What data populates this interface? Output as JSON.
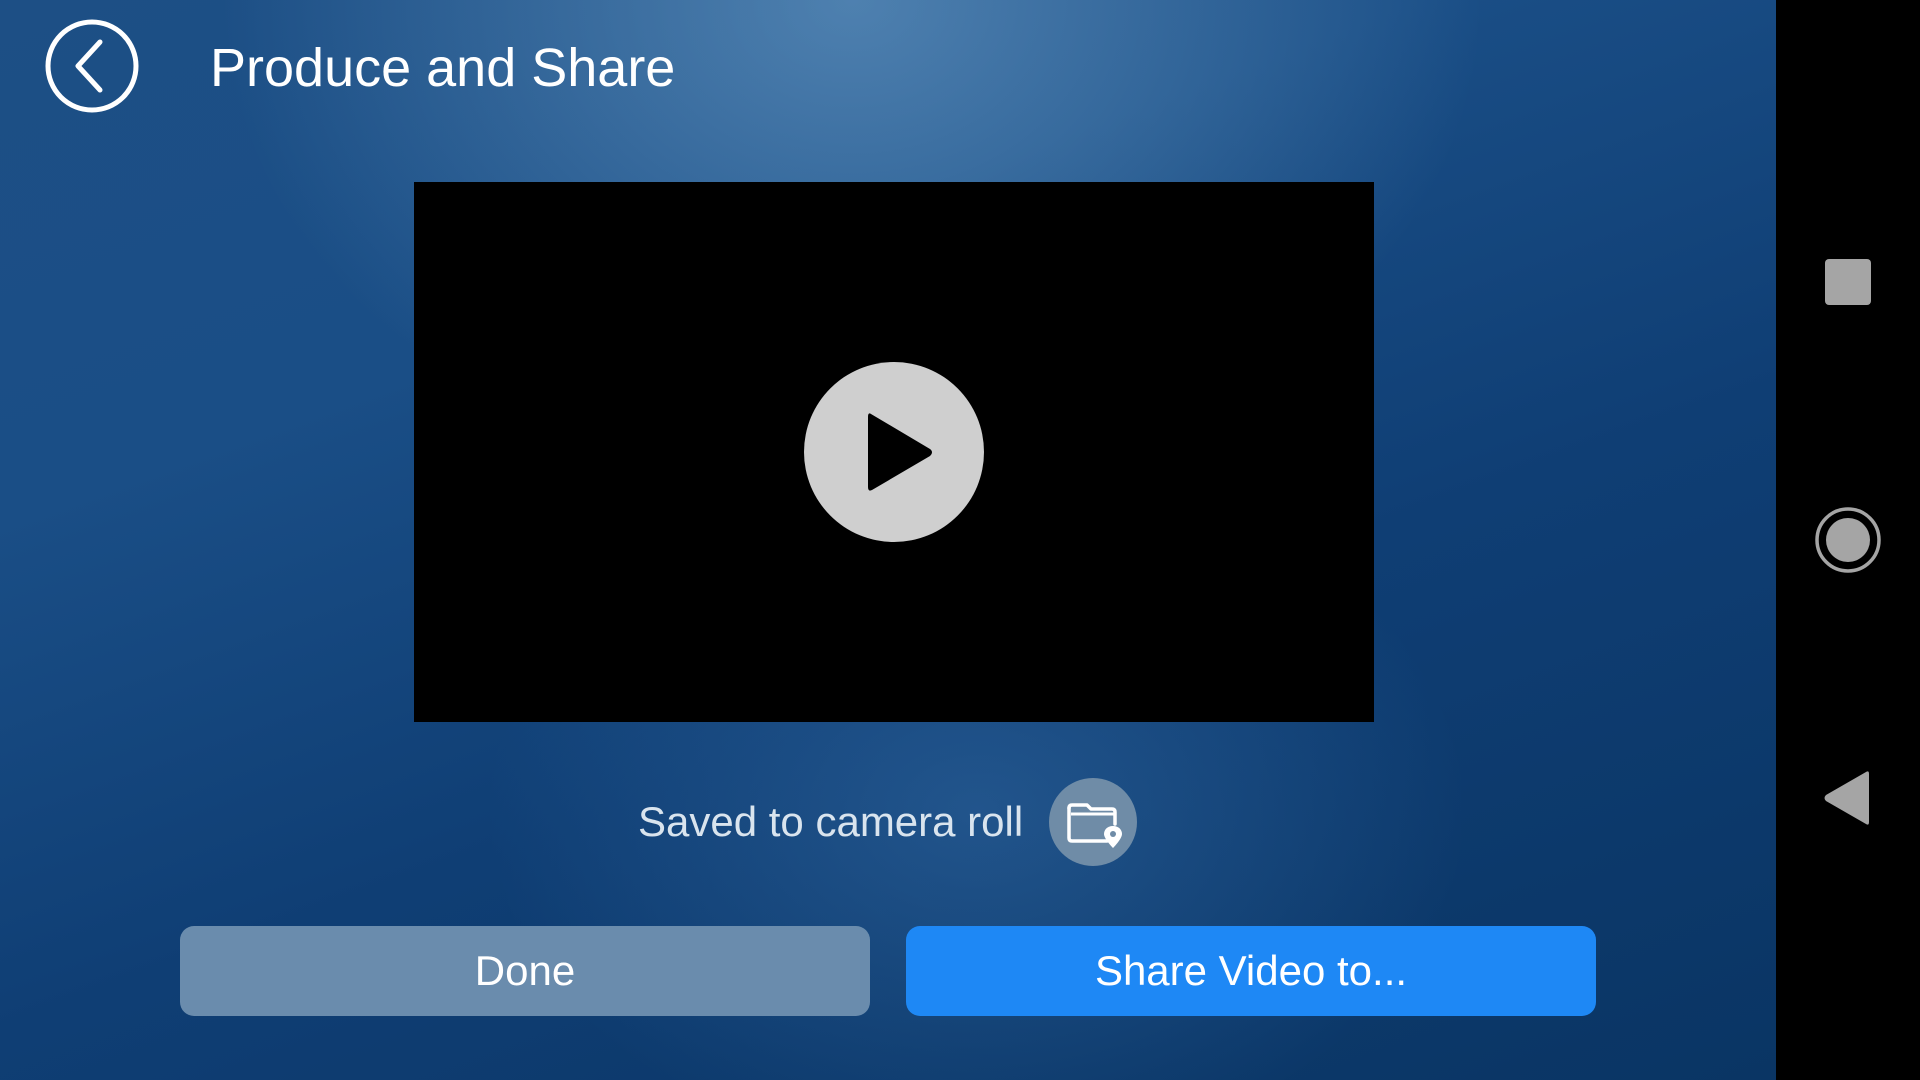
{
  "header": {
    "title": "Produce and Share",
    "back_icon": "chevron-left-circle-icon"
  },
  "video": {
    "play_icon": "play-icon",
    "background": "#000000"
  },
  "status": {
    "saved_text": "Saved to camera roll",
    "folder_icon": "folder-location-icon"
  },
  "actions": {
    "done_label": "Done",
    "share_label": "Share Video to...",
    "done_color": "#6a8cad",
    "share_color": "#1e88f5"
  },
  "system_nav": {
    "recents_icon": "square-icon",
    "home_icon": "circle-icon",
    "back_icon": "triangle-back-icon"
  }
}
